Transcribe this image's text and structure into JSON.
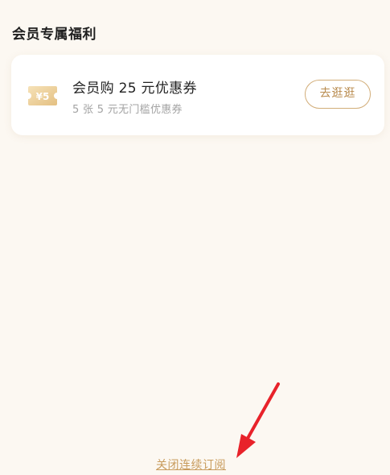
{
  "section": {
    "title": "会员专属福利"
  },
  "benefit_card": {
    "icon": "coupon-ticket-icon",
    "icon_text": "¥5",
    "title": "会员购 25 元优惠券",
    "subtitle": "5 张 5 元无门槛优惠券",
    "button_label": "去逛逛"
  },
  "footer": {
    "unsubscribe_label": "关闭连续订阅"
  },
  "annotation": {
    "icon": "red-arrow-icon",
    "color": "#e8222a"
  },
  "colors": {
    "background": "#fcf8f2",
    "accent_gold": "#c89b5c",
    "button_border": "#d2ad78",
    "subtitle_gray": "#a3a3a3"
  }
}
